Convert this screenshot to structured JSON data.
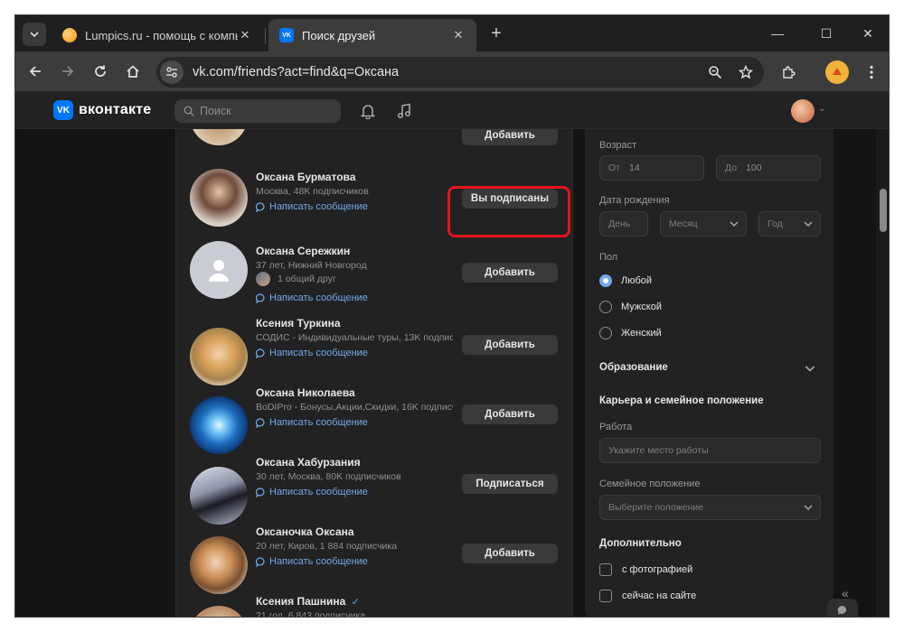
{
  "browser": {
    "tabs": [
      {
        "title": "Lumpics.ru - помощь с компь",
        "favicon_color": "#f39c12",
        "active": false
      },
      {
        "title": "Поиск друзей",
        "favicon_color": "#0077ff",
        "active": true
      }
    ],
    "new_tab_label": "+",
    "window_controls": {
      "minimize": "—",
      "maximize": "☐",
      "close": "✕"
    },
    "url": "vk.com/friends?act=find&q=Оксана"
  },
  "vk_header": {
    "logo_text": "вконтакте",
    "logo_mark": "VK",
    "search_placeholder": "Поиск"
  },
  "results": {
    "top_partial_button": "Добавить",
    "people": [
      {
        "name": "Оксана Бурматова",
        "sub": "Москва, 48K подписчиков",
        "message": "Написать сообщение",
        "button": "Вы подписаны"
      },
      {
        "name": "Оксана Сережкин",
        "sub": "37 лет, Нижний Новгород",
        "mutual": "1 общий друг",
        "message": "Написать сообщение",
        "button": "Добавить"
      },
      {
        "name": "Ксения Туркина",
        "sub": "СОДИС - Индивидуальные туры, 13K подписчиков",
        "message": "Написать сообщение",
        "button": "Добавить"
      },
      {
        "name": "Оксана Николаева",
        "sub": "BoDIPro - Бонусы,Акции,Скидки, 16K подписчиков",
        "message": "Написать сообщение",
        "button": "Добавить"
      },
      {
        "name": "Оксана Хабурзания",
        "sub": "30 лет, Москва, 80K подписчиков",
        "message": "Написать сообщение",
        "button": "Подписаться"
      },
      {
        "name": "Оксаночка Оксана",
        "sub": "20 лет, Киров, 1 884 подписчика",
        "message": "Написать сообщение",
        "button": "Добавить"
      },
      {
        "name": "Ксения Пашнина",
        "verified": "✓",
        "sub": "21 год, 6 843 подписчика",
        "message": "",
        "button": ""
      }
    ]
  },
  "filters": {
    "age_label": "Возраст",
    "age_from_prefix": "От",
    "age_from_value": "14",
    "age_to_prefix": "До",
    "age_to_value": "100",
    "birthdate_label": "Дата рождения",
    "day_placeholder": "День",
    "month_placeholder": "Месяц",
    "year_placeholder": "Год",
    "sex_label": "Пол",
    "sex_options": [
      "Любой",
      "Мужской",
      "Женский"
    ],
    "sex_selected": "Любой",
    "education_label": "Образование",
    "career_label": "Карьера и семейное положение",
    "work_label": "Работа",
    "work_placeholder": "Укажите место работы",
    "family_label": "Семейное положение",
    "family_placeholder": "Выберите положение",
    "extra_label": "Дополнительно",
    "extra_options": [
      "с фотографией",
      "сейчас на сайте"
    ]
  },
  "colors": {
    "accent_link": "#71aaeb",
    "vk_blue": "#0077ff",
    "highlight_red": "#e5141b"
  }
}
